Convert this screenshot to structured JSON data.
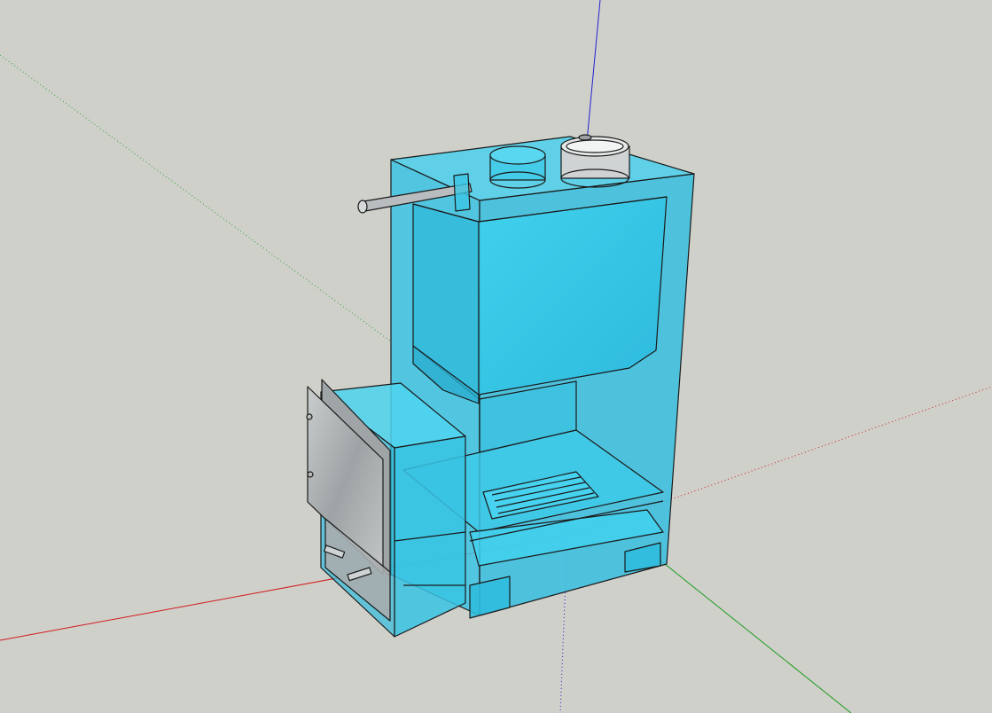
{
  "app": {
    "view": "3d-model-viewport"
  },
  "colors": {
    "background": "#d0d0cb",
    "axis_red": "#d11a1a",
    "axis_green": "#1a9a1a",
    "axis_blue": "#2020d0",
    "glass": "#39c6e6",
    "glass_dark": "#1ea9cc",
    "edge": "#1a1a1a",
    "metal": "#a9aeb0",
    "metal_light": "#d9dcdc"
  },
  "model": {
    "parts": [
      "outer-casing",
      "water-tank",
      "chimney-pipe",
      "water-pipe",
      "side-pipe",
      "firebox",
      "fuel-door",
      "ash-door",
      "grate",
      "ash-tray",
      "legs"
    ]
  }
}
